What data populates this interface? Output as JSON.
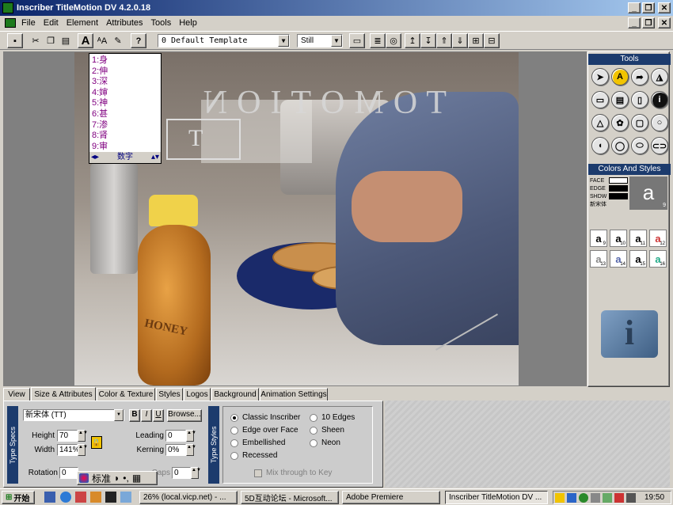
{
  "window": {
    "title": "Inscriber TitleMotion DV 4.2.0.18"
  },
  "menu": [
    "File",
    "Edit",
    "Element",
    "Attributes",
    "Tools",
    "Help"
  ],
  "toolbar": {
    "template_combo": "0  Default Template",
    "mode_combo": "Still",
    "help_label": "?"
  },
  "ime_candidates": {
    "items": [
      "1:身",
      "2:伸",
      "3:深",
      "4:婶",
      "5:神",
      "6:甚",
      "7:渗",
      "8:肾",
      "9:审"
    ],
    "footer_label": "数字"
  },
  "canvas_text": {
    "mirrored_title": "TOMOTION",
    "selection_letter": "T",
    "jar_label": "HONEY"
  },
  "tools_panel": {
    "title": "Tools",
    "tools": [
      "select-tool",
      "text-tool",
      "move-tool",
      "text-path-tool",
      "rect-tool",
      "frame-tool",
      "tall-rect-tool",
      "info-tool",
      "triangle-tool",
      "swirl-tool",
      "rounded-rect-tool",
      "circle-tool",
      "half-circle-tool",
      "ellipse-tool",
      "oval-tool",
      "capsule-tool"
    ]
  },
  "colors_panel": {
    "title": "Colors And Styles",
    "rows": [
      "FACE",
      "EDGE",
      "SHDW",
      "新宋体"
    ],
    "preview_letter": "a",
    "preview_number": "9",
    "styles": [
      {
        "letter": "a",
        "num": "9"
      },
      {
        "letter": "a",
        "num": "10"
      },
      {
        "letter": "a",
        "num": "11"
      },
      {
        "letter": "a",
        "num": "12"
      },
      {
        "letter": "a",
        "num": "13"
      },
      {
        "letter": "a",
        "num": "14"
      },
      {
        "letter": "a",
        "num": "15"
      },
      {
        "letter": "a",
        "num": "16"
      }
    ]
  },
  "tabs": [
    "View",
    "Size & Attributes",
    "Color & Texture",
    "Styles",
    "Logos",
    "Background",
    "Animation Settings"
  ],
  "active_tab": "Size & Attributes",
  "type_specs": {
    "section_label": "Type Specs",
    "font": "新宋体 (TT)",
    "bold": "B",
    "italic": "I",
    "underline": "U",
    "browse": "Browse...",
    "height_label": "Height",
    "height_value": "70",
    "width_label": "Width",
    "width_value": "141%",
    "leading_label": "Leading",
    "leading_value": "0",
    "kerning_label": "Kerning",
    "kerning_value": "0%",
    "rotation_label": "Rotation",
    "rotation_value": "0",
    "caps_label": "Caps",
    "caps_value": "0",
    "ime_bar": "标准"
  },
  "type_styles": {
    "section_label": "Type Styles",
    "options": [
      "Classic Inscriber",
      "Edge over Face",
      "Embellished",
      "Recessed",
      "10 Edges",
      "Sheen",
      "Neon"
    ],
    "selected": "Classic Inscriber",
    "checkbox_label": "Mix through to Key"
  },
  "taskbar": {
    "start": "开始",
    "tasks": [
      "26% (local.vicp.net) - ...",
      "5D互动论坛 - Microsoft...",
      "Adobe Premiere",
      "Inscriber TitleMotion DV ..."
    ],
    "clock": "19:50"
  }
}
